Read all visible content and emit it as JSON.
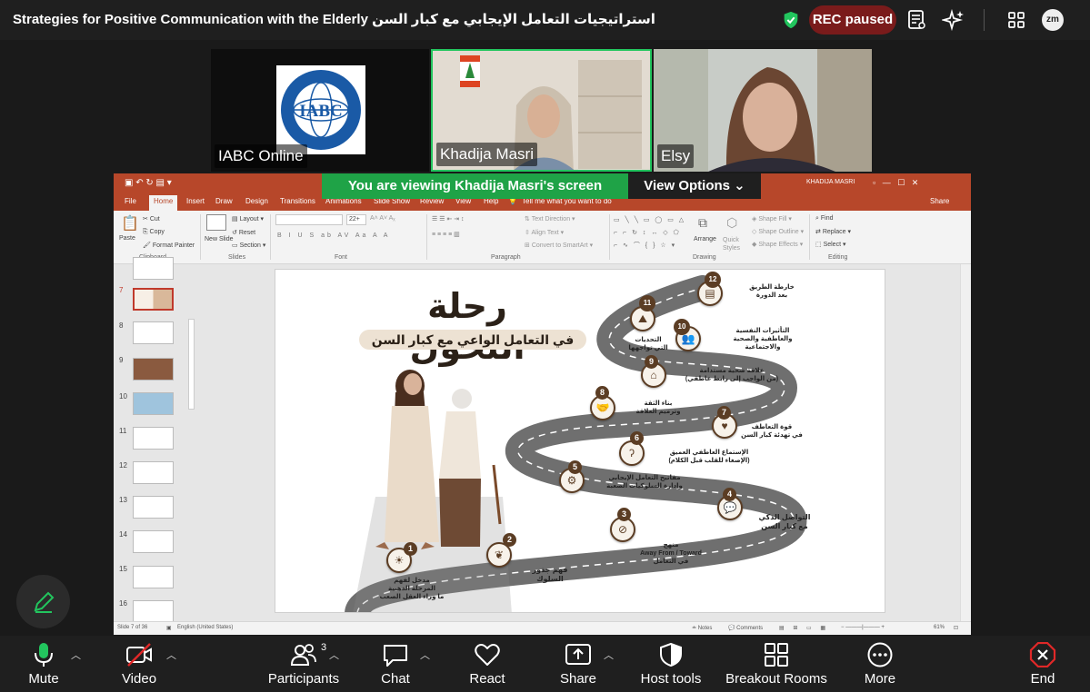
{
  "meeting": {
    "title": "Strategies for Positive Communication with the Elderly استراتيجيات التعامل الإيجابي مع كبار السن",
    "rec_label": "REC paused",
    "avatar_text": "zm"
  },
  "participants_tiles": [
    {
      "name": "IABC Online",
      "logo_text": "IABC"
    },
    {
      "name": "Khadija Masri"
    },
    {
      "name": "Elsy"
    }
  ],
  "view_banner": {
    "viewing_text": "You are viewing  Khadija Masri's screen",
    "options_label": "View Options"
  },
  "ppt": {
    "user": "KHADIJA MASRI",
    "share": "Share",
    "tabs": [
      "File",
      "Home",
      "Insert",
      "Draw",
      "Design",
      "Transitions",
      "Animations",
      "Slide Show",
      "Review",
      "View",
      "Help"
    ],
    "tell_me": "Tell me what you want to do",
    "ribbon": {
      "paste": "Paste",
      "cut": "Cut",
      "copy": "Copy",
      "format_painter": "Format Painter",
      "new_slide": "New Slide",
      "layout": "Layout",
      "reset": "Reset",
      "section": "Section",
      "text_direction": "Text Direction",
      "align_text": "Align Text",
      "convert_smartart": "Convert to SmartArt",
      "arrange": "Arrange",
      "quick_styles": "Quick Styles",
      "shape_fill": "Shape Fill",
      "shape_outline": "Shape Outline",
      "shape_effects": "Shape Effects",
      "find": "Find",
      "replace": "Replace",
      "select": "Select",
      "font_size": "22+",
      "groups": [
        "Clipboard",
        "Slides",
        "Font",
        "Paragraph",
        "Drawing",
        "Editing"
      ]
    },
    "slide_numbers": [
      "7",
      "8",
      "9",
      "10",
      "11",
      "12",
      "13",
      "14",
      "15",
      "16"
    ],
    "status": {
      "slide_of": "Slide 7 of 36",
      "language": "English (United States)",
      "notes": "Notes",
      "comments": "Comments",
      "zoom": "61%"
    }
  },
  "slide": {
    "title": "رحلة التحول",
    "subtitle": "في التعامل الواعي مع كبار السن",
    "steps": [
      {
        "n": "1",
        "text": "مدخل لفهم\nالمرحلة الذهبية\nما وراء العقل الصعب"
      },
      {
        "n": "2",
        "text": "فهم جذور\nالسلوك"
      },
      {
        "n": "3",
        "text": "منهج\nAway From / Toward\nفي التعامل"
      },
      {
        "n": "4",
        "text": "التواصل الذكي\nمع كبار السن"
      },
      {
        "n": "5",
        "text": "مفاتيح التعامل الإيجابي\nوإدارة السلوكيات الصعبة"
      },
      {
        "n": "6",
        "text": "الإستماع العاطفي العميق\n(الإصغاء للقلب قبل الكلام)"
      },
      {
        "n": "7",
        "text": "قوة التعاطف\nفي تهدئة كبار السن"
      },
      {
        "n": "8",
        "text": "بناء الثقة\nوترميم العلاقة"
      },
      {
        "n": "9",
        "text": "علاقة صحية مستدامة\n(من الواجب إلى رابط عاطفي)"
      },
      {
        "n": "10",
        "text": "التأثيرات النفسية\nوالعاطفية والصحية\nوالاجتماعية"
      },
      {
        "n": "11",
        "text": "التحديات\nالتي تواجهها"
      },
      {
        "n": "12",
        "text": "خارطة الطريق\nبعد الدورة"
      }
    ]
  },
  "toolbar": {
    "mute": "Mute",
    "video": "Video",
    "participants": "Participants",
    "participants_count": "3",
    "chat": "Chat",
    "react": "React",
    "share": "Share",
    "host_tools": "Host tools",
    "breakout": "Breakout Rooms",
    "more": "More",
    "end": "End"
  },
  "colors": {
    "accent_green": "#1fa347",
    "rec_red": "#7a1b1b",
    "ppt_orange": "#b7472a",
    "end_red": "#e02828",
    "road_brown": "#5b3d24"
  }
}
